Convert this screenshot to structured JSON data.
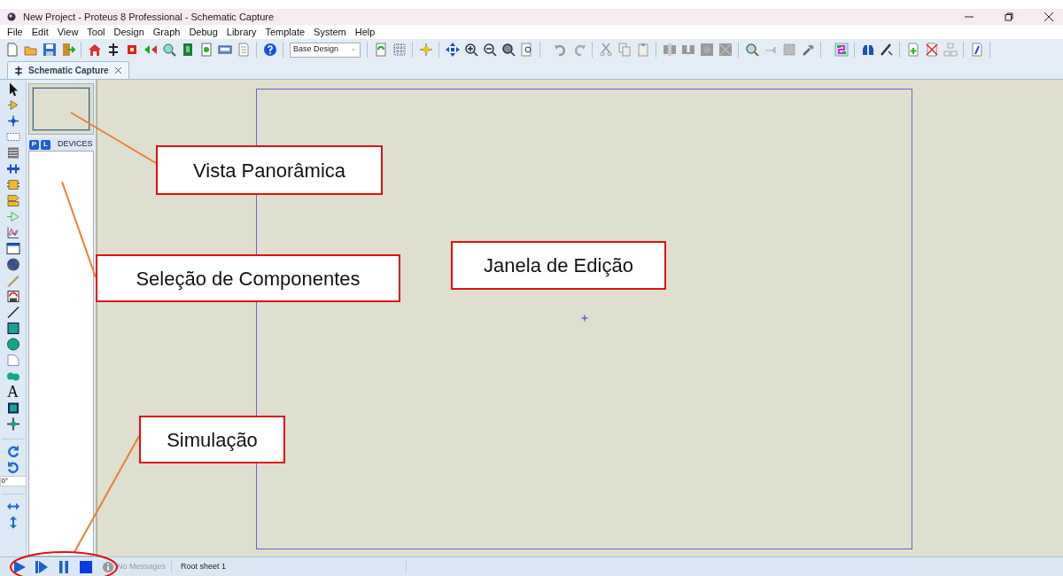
{
  "window": {
    "title": "New Project - Proteus 8 Professional - Schematic Capture"
  },
  "menu": [
    "File",
    "Edit",
    "View",
    "Tool",
    "Design",
    "Graph",
    "Debug",
    "Library",
    "Template",
    "System",
    "Help"
  ],
  "toolbar": {
    "variant_combo": "Base Design"
  },
  "tabs": [
    {
      "label": "Schematic Capture",
      "selected": true
    }
  ],
  "tool_panel": {
    "text_tool_glyph": "A",
    "rotation": "0°"
  },
  "device_panel": {
    "buttons": [
      "P",
      "L"
    ],
    "title": "DEVICES"
  },
  "status_bar": {
    "message": "No Messages",
    "sheet": "Root sheet 1"
  },
  "annotations": [
    {
      "text": "Vista Panorâmica"
    },
    {
      "text": "Seleção de Componentes"
    },
    {
      "text": "Janela de Edição"
    },
    {
      "text": "Simulação"
    }
  ]
}
